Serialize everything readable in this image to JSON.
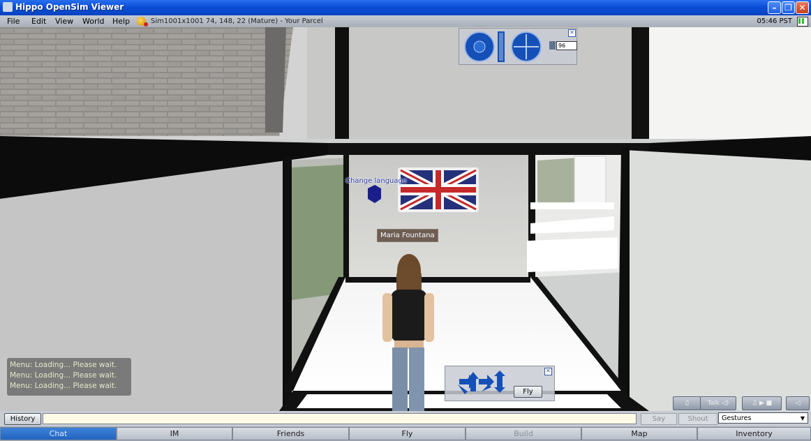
{
  "window": {
    "title": "Hippo OpenSim Viewer"
  },
  "menu": {
    "items": [
      "File",
      "Edit",
      "View",
      "World",
      "Help"
    ],
    "location": "Sim1001x1001 74, 148, 22 (Mature) - Your Parcel",
    "clock": "05:46 PST"
  },
  "scene": {
    "change_language_label": "Change language",
    "avatar_name": "Maria Fountana",
    "camera": {
      "zoom_value": "96"
    },
    "movement": {
      "fly_label": "Fly"
    },
    "chat_log": [
      "Menu: Loading... Please wait.",
      "Menu: Loading... Please wait.",
      "Menu: Loading... Please wait."
    ],
    "voice": {
      "talk_label": "Talk"
    }
  },
  "chatbar": {
    "history_label": "History",
    "input_value": "",
    "say_label": "Say",
    "shout_label": "Shout",
    "gestures_label": "Gestures"
  },
  "tabs": [
    {
      "label": "Chat",
      "state": "active"
    },
    {
      "label": "IM",
      "state": "normal"
    },
    {
      "label": "Friends",
      "state": "normal"
    },
    {
      "label": "Fly",
      "state": "normal"
    },
    {
      "label": "Build",
      "state": "disabled"
    },
    {
      "label": "Map",
      "state": "normal"
    },
    {
      "label": "Inventory",
      "state": "normal"
    }
  ],
  "colors": {
    "titlebar": "#0a4fd8",
    "active_tab": "#2a6bc8",
    "camera_widget": "#1550b8"
  }
}
